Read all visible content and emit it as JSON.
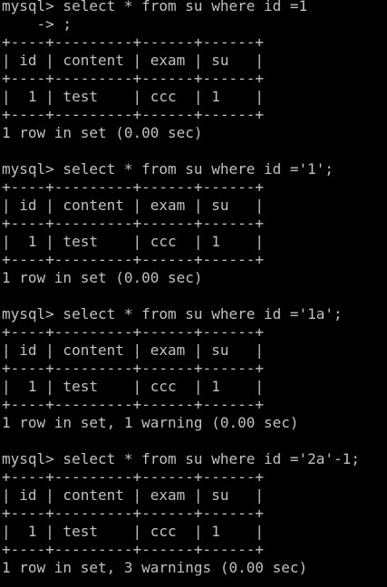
{
  "terminal": {
    "colors": {
      "background": "#000000",
      "text": "#c0c0c0"
    },
    "lines": [
      "mysql> select * from su where id =1",
      "    -> ;",
      "+----+---------+------+------+",
      "| id | content | exam | su   |",
      "+----+---------+------+------+",
      "|  1 | test    | ccc  | 1    |",
      "+----+---------+------+------+",
      "1 row in set (0.00 sec)",
      "",
      "mysql> select * from su where id ='1';",
      "+----+---------+------+------+",
      "| id | content | exam | su   |",
      "+----+---------+------+------+",
      "|  1 | test    | ccc  | 1    |",
      "+----+---------+------+------+",
      "1 row in set (0.00 sec)",
      "",
      "mysql> select * from su where id ='1a';",
      "+----+---------+------+------+",
      "| id | content | exam | su   |",
      "+----+---------+------+------+",
      "|  1 | test    | ccc  | 1    |",
      "+----+---------+------+------+",
      "1 row in set, 1 warning (0.00 sec)",
      "",
      "mysql> select * from su where id ='2a'-1;",
      "+----+---------+------+------+",
      "| id | content | exam | su   |",
      "+----+---------+------+------+",
      "|  1 | test    | ccc  | 1    |",
      "+----+---------+------+------+",
      "1 row in set, 3 warnings (0.00 sec)"
    ]
  }
}
